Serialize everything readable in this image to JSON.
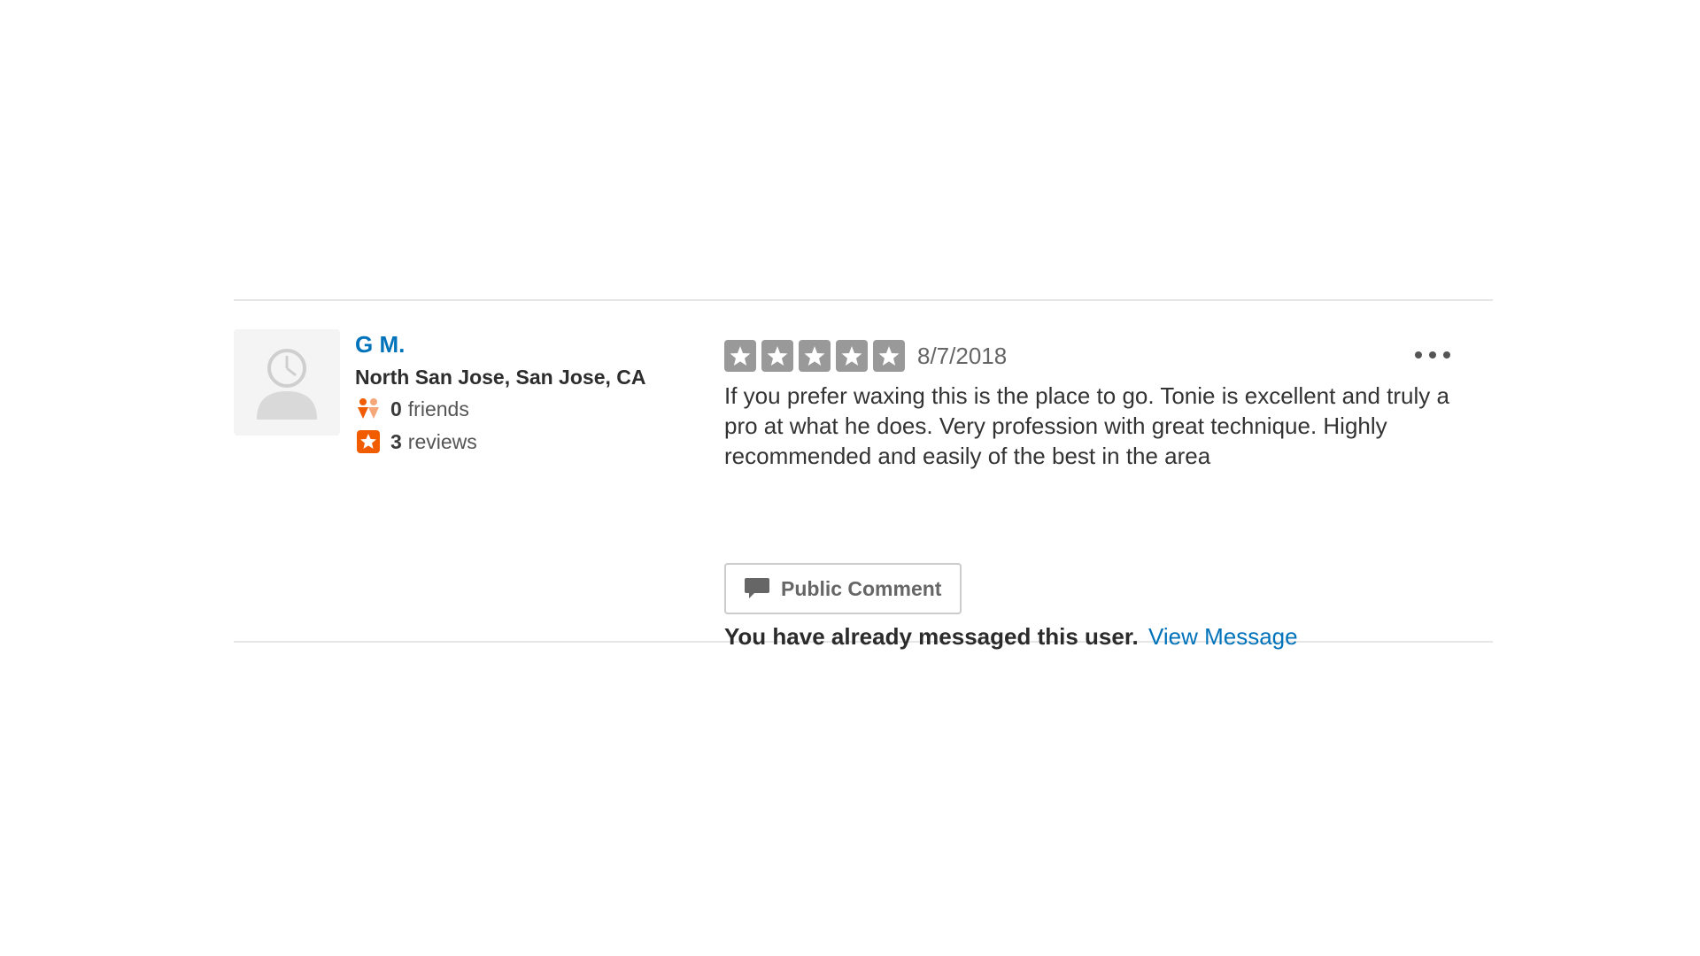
{
  "user": {
    "name": "G M.",
    "location": "North San Jose, San Jose, CA",
    "friends_count": "0",
    "friends_label": "friends",
    "reviews_count": "3",
    "reviews_label": "reviews"
  },
  "review": {
    "rating": 5,
    "rating_max": 5,
    "date": "8/7/2018",
    "text": "If you prefer waxing this is the place to go. Tonie is excellent and truly a pro at what he does. Very profession with great technique. Highly recommended and easily of the best in the area"
  },
  "actions": {
    "public_comment_label": "Public Comment",
    "messaged_text": "You have already messaged this user.",
    "view_message_label": "View Message"
  },
  "icons": {
    "avatar": "default-user-avatar-icon",
    "friends": "friends-icon",
    "reviews": "review-star-icon",
    "star": "star-icon",
    "more": "more-options-icon",
    "comment": "speech-bubble-icon"
  },
  "colors": {
    "link": "#0073bb",
    "star_box": "#999999",
    "review_badge": "#f15c00",
    "friends_icon": "#f15c00",
    "divider": "#e6e6e6"
  }
}
